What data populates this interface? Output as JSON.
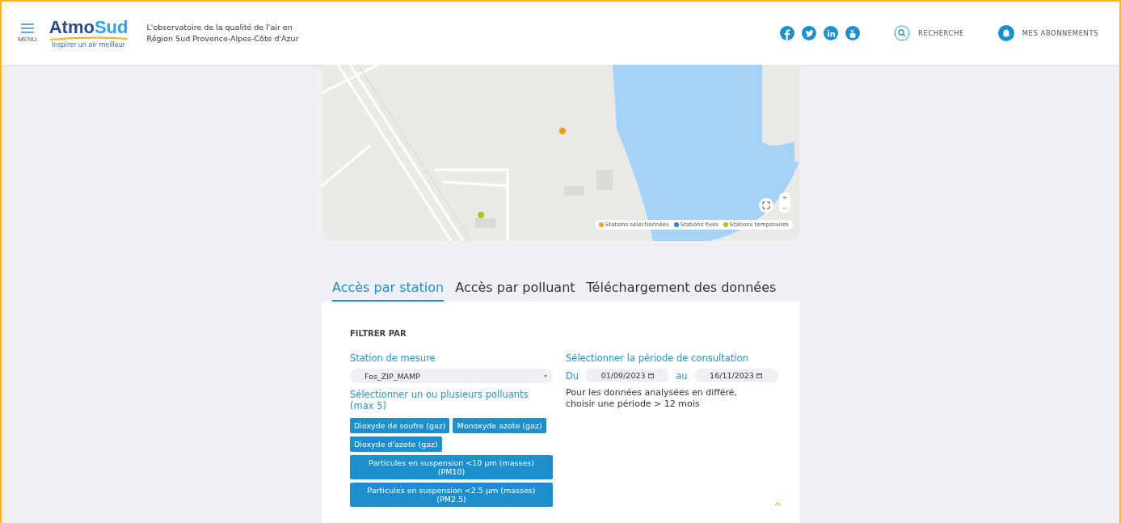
{
  "header": {
    "menu_label": "MENU",
    "logo": {
      "name_part1": "Atmo",
      "name_part2": "Sud",
      "tagline": "Inspirer un air meilleur"
    },
    "subtitle_line1": "L'observatoire de la qualité de l'air en",
    "subtitle_line2": "Région Sud Provence-Alpes-Côte d'Azur",
    "social": [
      {
        "kind": "facebook"
      },
      {
        "kind": "twitter"
      },
      {
        "kind": "linkedin"
      },
      {
        "kind": "youtube"
      }
    ],
    "search_label": "RECHERCHE",
    "subscriptions_label": "MES ABONNEMENTS"
  },
  "map": {
    "legend": [
      {
        "label": "Stations sélectionnées",
        "color": "#f39c12"
      },
      {
        "label": "Stations fixes",
        "color": "#1b8fd2"
      },
      {
        "label": "Stations temporaires",
        "color": "#a8c61a"
      }
    ],
    "zoom_in": "+",
    "zoom_out": "−"
  },
  "tabs": [
    {
      "label": "Accès par station",
      "selected": true
    },
    {
      "label": "Accès par polluant",
      "selected": false
    },
    {
      "label": "Téléchargement des données",
      "selected": false
    }
  ],
  "filter": {
    "title": "FILTRER PAR",
    "station_label": "Station de mesure",
    "station_value": "Fos_ZIP_MAMP",
    "pollutants_label": "Sélectionner un ou plusieurs polluants (max 5)",
    "pollutants": [
      {
        "label": "Dioxyde de soufre (gaz)",
        "selected": true
      },
      {
        "label": "Monoxyde azote (gaz)",
        "selected": true
      },
      {
        "label": "Dioxyde d'azote (gaz)",
        "selected": true
      },
      {
        "label": "Particules en suspension <10 µm (masses) (PM10)",
        "selected": true
      },
      {
        "label": "Particules en suspension <2.5 µm (masses) (PM2.5)",
        "selected": true
      }
    ],
    "period_label": "Sélectionner la période de consultation",
    "from_label": "Du",
    "from_value": "01/09/2023",
    "to_label": "au",
    "to_value": "16/11/2023",
    "note": "Pour les données analysées en différé, choisir une période > 12 mois"
  }
}
